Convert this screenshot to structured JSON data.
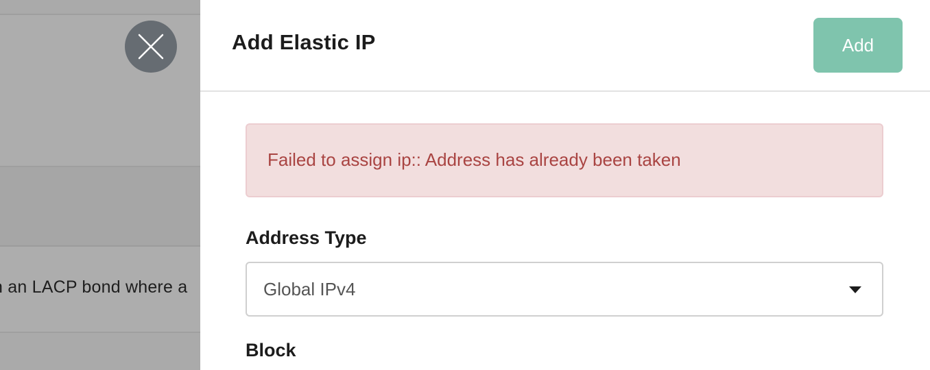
{
  "background": {
    "visible_text": "n an LACP bond where a"
  },
  "close_button": {
    "icon": "close-icon"
  },
  "drawer": {
    "title": "Add Elastic IP",
    "add_label": "Add",
    "alert_message": "Failed to assign ip:: Address has already been taken",
    "address_type": {
      "label": "Address Type",
      "selected": "Global IPv4"
    },
    "block": {
      "label": "Block"
    }
  },
  "colors": {
    "add_button": "#7fc4ad",
    "alert_background": "#f2dede",
    "alert_text": "#a94442",
    "close_button": "#666c72"
  }
}
